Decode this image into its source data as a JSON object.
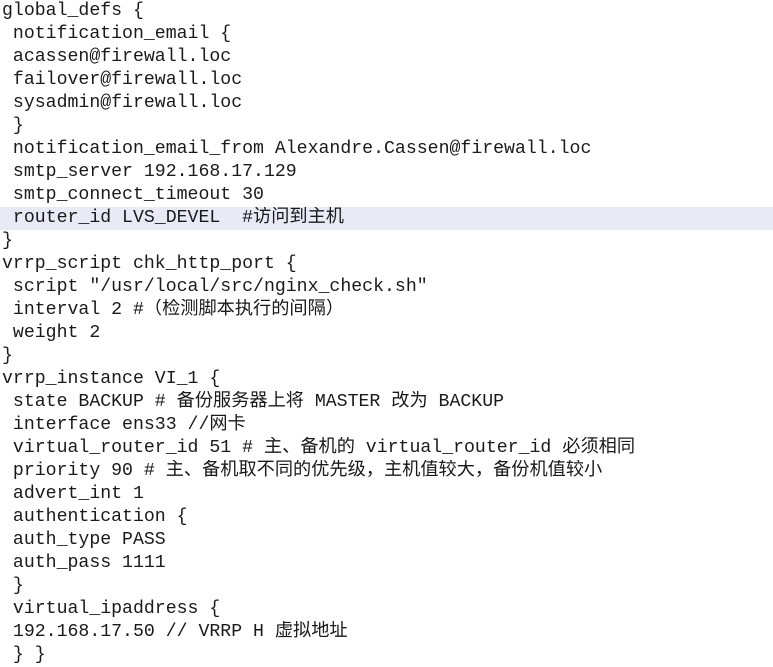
{
  "document": {
    "highlight_color": "#e8eaf6",
    "lines": [
      "global_defs {",
      " notification_email {",
      " acassen@firewall.loc",
      " failover@firewall.loc",
      " sysadmin@firewall.loc",
      " }",
      " notification_email_from Alexandre.Cassen@firewall.loc",
      " smtp_server 192.168.17.129",
      " smtp_connect_timeout 30",
      " router_id LVS_DEVEL  #访问到主机",
      "}",
      "vrrp_script chk_http_port {",
      " script \"/usr/local/src/nginx_check.sh\"",
      " interval 2 #（检测脚本执行的间隔）",
      " weight 2",
      "}",
      "vrrp_instance VI_1 {",
      " state BACKUP # 备份服务器上将 MASTER 改为 BACKUP",
      " interface ens33 //网卡",
      " virtual_router_id 51 # 主、备机的 virtual_router_id 必须相同",
      " priority 90 # 主、备机取不同的优先级，主机值较大，备份机值较小",
      " advert_int 1",
      " authentication {",
      " auth_type PASS",
      " auth_pass 1111",
      " }",
      " virtual_ipaddress {",
      " 192.168.17.50 // VRRP H 虚拟地址",
      " } }"
    ]
  }
}
